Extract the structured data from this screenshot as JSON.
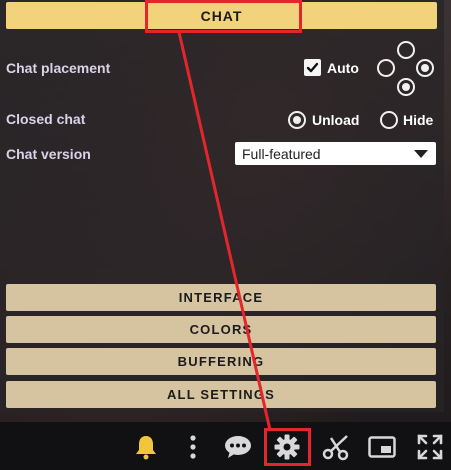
{
  "tabs": {
    "chat_label": "CHAT"
  },
  "chat_settings": {
    "placement": {
      "label": "Chat placement",
      "auto_label": "Auto",
      "auto_checked": true,
      "position_selected": "right"
    },
    "closed_chat": {
      "label": "Closed chat",
      "options": [
        "Unload",
        "Hide"
      ],
      "selected": "Unload"
    },
    "version": {
      "label": "Chat version",
      "selected": "Full-featured"
    }
  },
  "menu": {
    "interface": "INTERFACE",
    "colors": "COLORS",
    "buffering": "BUFFERING",
    "all_settings": "ALL SETTINGS"
  },
  "player_controls": [
    "bell-icon",
    "more-vertical-icon",
    "chat-bubble-icon",
    "settings-gear-icon",
    "clip-scissors-icon",
    "picture-in-picture-icon",
    "fullscreen-icon"
  ],
  "colors": {
    "tab_active": "#f2d27a",
    "menu_button": "#d6c4a0",
    "highlight": "#e3262c",
    "label": "#d9d3e8"
  }
}
